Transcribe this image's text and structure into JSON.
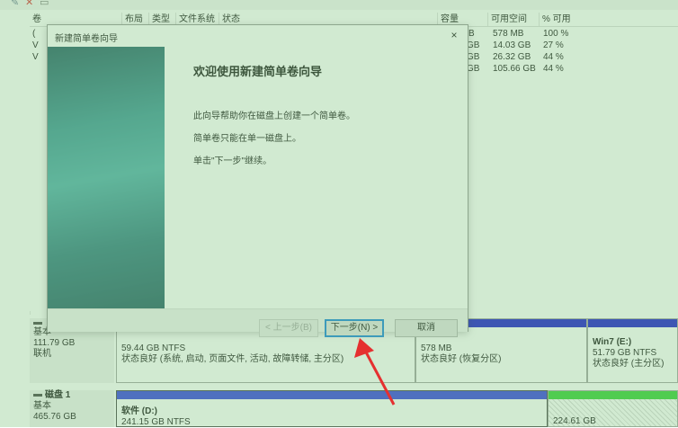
{
  "colors": {
    "primary_bar": "#0000cc",
    "blue_bar": "#1f2ee0",
    "green_bar": "#22cc22",
    "overlay": "#92ce92",
    "arrow": "#e53030"
  },
  "icons": {
    "edit": "pencil-icon",
    "delete": "delete-x-icon",
    "properties": "properties-icon"
  },
  "volume_list": {
    "headers": [
      "卷",
      "布局",
      "类型",
      "文件系统",
      "状态",
      "容量",
      "可用空间",
      "% 可用"
    ],
    "rows": [
      {
        "vol": "(",
        "cap": "B",
        "free": "578 MB",
        "pct": "100 %"
      },
      {
        "vol": "V",
        "cap": "GB",
        "free": "14.03 GB",
        "pct": "27 %"
      },
      {
        "vol": "V",
        "cap": "GB",
        "free": "26.32 GB",
        "pct": "44 %"
      },
      {
        "vol": "",
        "cap": "GB",
        "free": "105.66 GB",
        "pct": "44 %"
      }
    ]
  },
  "dialog": {
    "title": "新建简单卷向导",
    "close_label": "×",
    "heading": "欢迎使用新建简单卷向导",
    "para1": "此向导帮助你在磁盘上创建一个简单卷。",
    "para2": "简单卷只能在单一磁盘上。",
    "para3": "单击\"下一步\"继续。",
    "back_label": "< 上一步(B)",
    "next_label": "下一步(N) >",
    "cancel_label": "取消"
  },
  "disks": {
    "disk0": {
      "type": "基本",
      "size": "111.79 GB",
      "status": "联机",
      "partitions": [
        {
          "size": "59.44 GB NTFS",
          "status": "状态良好 (系统, 启动, 页面文件, 活动, 故障转储, 主分区)"
        },
        {
          "size": "578 MB",
          "status": "状态良好 (恢复分区)"
        },
        {
          "name": "Win7  (E:)",
          "size": "51.79 GB NTFS",
          "status": "状态良好 (主分区)"
        }
      ]
    },
    "disk1": {
      "name": "磁盘 1",
      "type": "基本",
      "size": "465.76 GB",
      "partitions": [
        {
          "name": "软件 (D:)",
          "size": "241.15 GB NTFS"
        },
        {
          "size": "224.61 GB"
        }
      ]
    }
  }
}
